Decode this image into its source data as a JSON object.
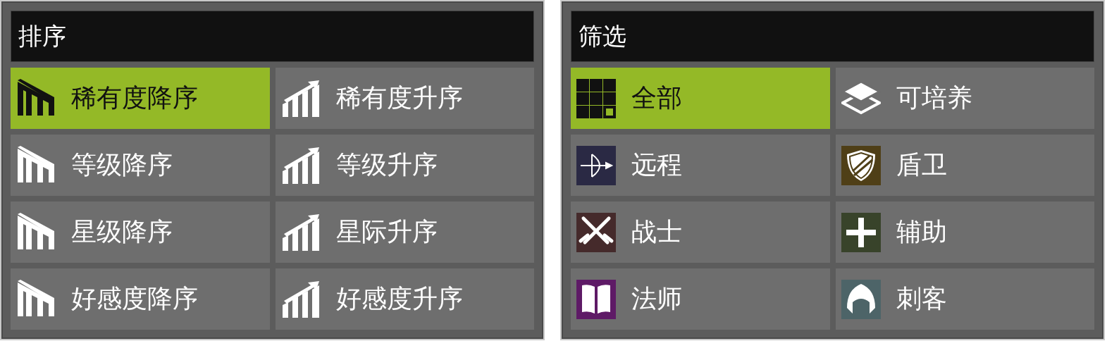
{
  "panels": [
    {
      "title": "排序",
      "items": [
        {
          "label": "稀有度降序",
          "kind": "sort_desc",
          "selected": true
        },
        {
          "label": "稀有度升序",
          "kind": "sort_asc",
          "selected": false
        },
        {
          "label": "等级降序",
          "kind": "sort_desc",
          "selected": false
        },
        {
          "label": "等级升序",
          "kind": "sort_asc",
          "selected": false
        },
        {
          "label": "星级降序",
          "kind": "sort_desc",
          "selected": false
        },
        {
          "label": "星际升序",
          "kind": "sort_asc",
          "selected": false
        },
        {
          "label": "好感度降序",
          "kind": "sort_desc",
          "selected": false
        },
        {
          "label": "好感度升序",
          "kind": "sort_asc",
          "selected": false
        }
      ]
    },
    {
      "title": "筛选",
      "items": [
        {
          "label": "全部",
          "kind": "all",
          "selected": true
        },
        {
          "label": "可培养",
          "kind": "layers",
          "selected": false
        },
        {
          "label": "远程",
          "kind": "bow",
          "color": "#2a2944",
          "selected": false
        },
        {
          "label": "盾卫",
          "kind": "shield",
          "color": "#4f3f17",
          "selected": false
        },
        {
          "label": "战士",
          "kind": "swords",
          "color": "#452a2b",
          "selected": false
        },
        {
          "label": "辅助",
          "kind": "plus",
          "color": "#38432a",
          "selected": false
        },
        {
          "label": "法师",
          "kind": "book",
          "color": "#5e1a66",
          "selected": false
        },
        {
          "label": "刺客",
          "kind": "hood",
          "color": "#4d6468",
          "selected": false
        }
      ]
    }
  ]
}
